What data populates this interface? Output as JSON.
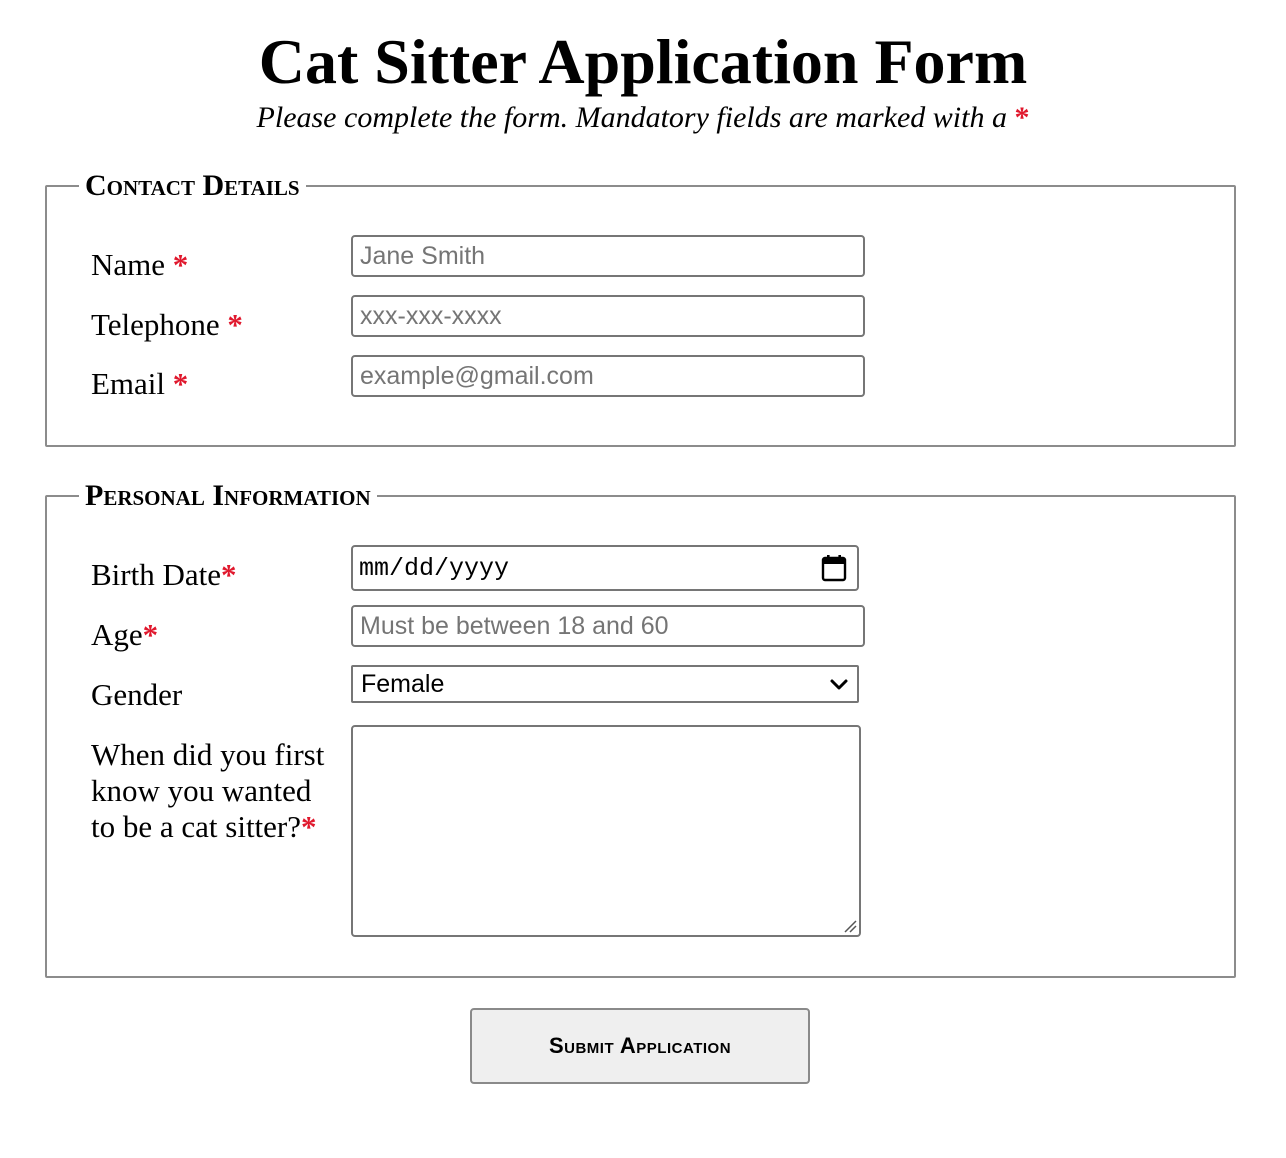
{
  "header": {
    "title": "Cat Sitter Application Form",
    "subtitle": "Please complete the form. Mandatory fields are marked with a",
    "required_marker": "*"
  },
  "contact": {
    "legend": "Contact Details",
    "name_label": "Name",
    "name_placeholder": "Jane Smith",
    "telephone_label": "Telephone",
    "telephone_placeholder": "xxx-xxx-xxxx",
    "email_label": "Email",
    "email_placeholder": "example@gmail.com"
  },
  "personal": {
    "legend": "Personal Information",
    "birthdate_label": "Birth Date",
    "birthdate_placeholder": "mm/dd/yyyy",
    "age_label": "Age",
    "age_placeholder": "Must be between 18 and 60",
    "gender_label": "Gender",
    "gender_selected": "Female",
    "question_label": "When did you first know you wanted to be a cat sitter?",
    "question_value": ""
  },
  "actions": {
    "submit_label": "Submit Application"
  },
  "colors": {
    "required": "#e0182d",
    "border": "#767676",
    "button_bg": "#efefef"
  },
  "icons": {
    "calendar": "calendar-icon",
    "dropdown": "chevron-down-icon",
    "resize": "resize-grip-icon"
  }
}
